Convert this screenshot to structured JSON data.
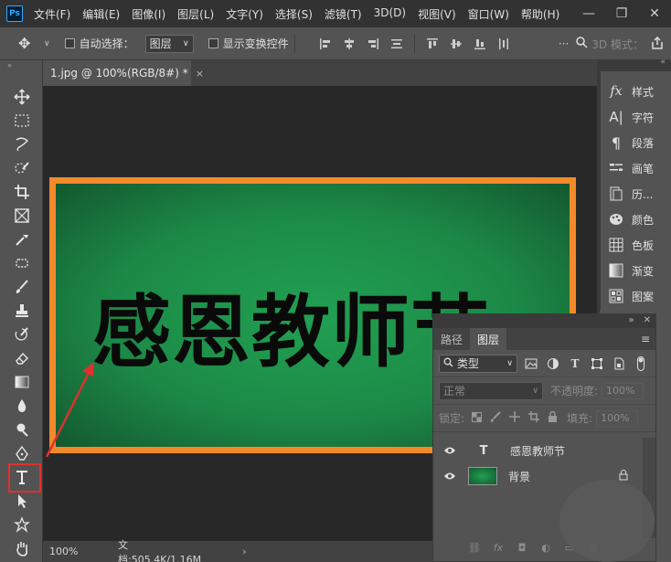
{
  "menubar": {
    "logo": "Ps",
    "items": [
      "文件(F)",
      "编辑(E)",
      "图像(I)",
      "图层(L)",
      "文字(Y)",
      "选择(S)",
      "滤镜(T)",
      "3D(D)",
      "视图(V)",
      "窗口(W)",
      "帮助(H)"
    ],
    "minimize": "—",
    "restore": "❐",
    "close": "✕"
  },
  "options": {
    "auto_select_label": "自动选择：",
    "auto_select_value": "图层",
    "show_transform_label": "显示变换控件",
    "mode_3d": "3D 模式："
  },
  "document": {
    "tab_title": "1.jpg @ 100%(RGB/8#) *",
    "tab_close": "×",
    "artwork_text": "感恩教师节"
  },
  "status": {
    "zoom": "100%",
    "doc_info": "文档:505.4K/1.16M",
    "caret": "›"
  },
  "right_dock": {
    "items": [
      {
        "label": "样式",
        "icon": "fx"
      },
      {
        "label": "字符",
        "icon": "A|"
      },
      {
        "label": "段落",
        "icon": "¶"
      },
      {
        "label": "画笔",
        "icon": "brush"
      },
      {
        "label": "历...",
        "icon": "history"
      },
      {
        "label": "颜色",
        "icon": "palette"
      },
      {
        "label": "色板",
        "icon": "grid"
      },
      {
        "label": "渐变",
        "icon": "gradient"
      },
      {
        "label": "图案",
        "icon": "pattern"
      }
    ]
  },
  "layers_panel": {
    "tabs": [
      "路径",
      "图层"
    ],
    "active_tab": "图层",
    "menu": "≡",
    "filter_type": "类型",
    "blend_mode": "正常",
    "opacity_label": "不透明度:",
    "opacity_value": "100%",
    "lock_label": "锁定:",
    "fill_label": "填充:",
    "fill_value": "100%",
    "layers": [
      {
        "name": "感恩教师节",
        "kind": "T"
      },
      {
        "name": "背景",
        "kind": "image"
      }
    ],
    "footer_fx": "fx"
  },
  "colors": {
    "accent_orange": "#f28a2a",
    "board_green": "#1c8a47",
    "highlight_red": "#e03030"
  }
}
